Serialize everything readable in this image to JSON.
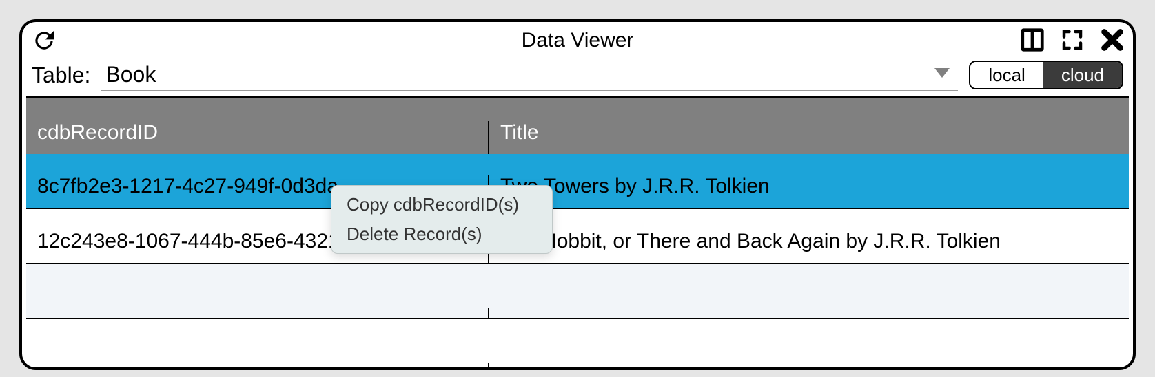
{
  "window": {
    "title": "Data Viewer",
    "table_label": "Table:",
    "table_selected": "Book",
    "toggle": {
      "local": "local",
      "cloud": "cloud",
      "active": "cloud"
    }
  },
  "columns": {
    "id": "cdbRecordID",
    "title": "Title"
  },
  "rows": [
    {
      "id": "8c7fb2e3-1217-4c27-949f-0d3da",
      "title": "Two Towers by J.R.R. Tolkien",
      "selected": true
    },
    {
      "id": "12c243e8-1067-444b-85e6-4321c230b233",
      "title": "The Hobbit, or There and Back Again by J.R.R. Tolkien",
      "selected": false
    }
  ],
  "context_menu": {
    "copy": "Copy cdbRecordID(s)",
    "delete": "Delete Record(s)"
  }
}
